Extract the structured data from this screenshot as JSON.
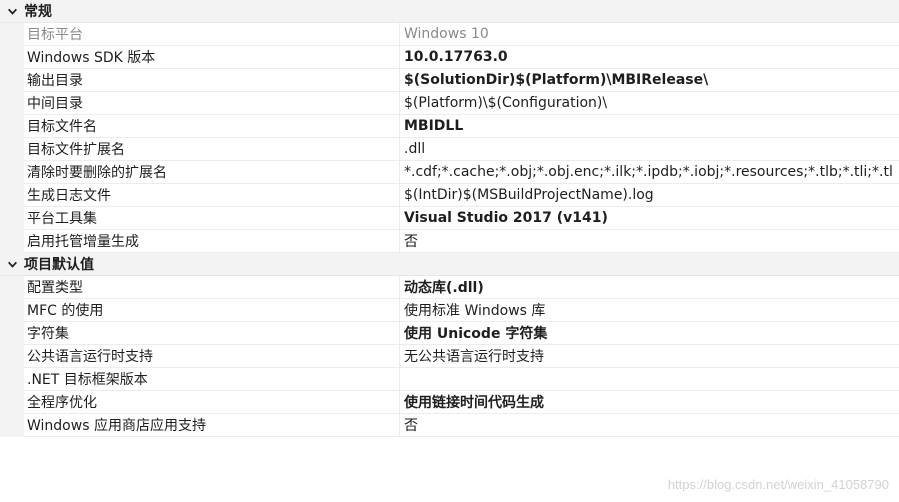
{
  "sections": [
    {
      "title": "常规",
      "rows": [
        {
          "name": "目标平台",
          "value": "Windows 10"
        },
        {
          "name": "Windows SDK 版本",
          "value": "10.0.17763.0"
        },
        {
          "name": "输出目录",
          "value": "$(SolutionDir)$(Platform)\\MBIRelease\\"
        },
        {
          "name": "中间目录",
          "value": "$(Platform)\\$(Configuration)\\"
        },
        {
          "name": "目标文件名",
          "value": "MBIDLL"
        },
        {
          "name": "目标文件扩展名",
          "value": ".dll"
        },
        {
          "name": "清除时要删除的扩展名",
          "value": "*.cdf;*.cache;*.obj;*.obj.enc;*.ilk;*.ipdb;*.iobj;*.resources;*.tlb;*.tli;*.tl"
        },
        {
          "name": "生成日志文件",
          "value": "$(IntDir)$(MSBuildProjectName).log"
        },
        {
          "name": "平台工具集",
          "value": "Visual Studio 2017 (v141)"
        },
        {
          "name": "启用托管增量生成",
          "value": "否"
        }
      ]
    },
    {
      "title": "项目默认值",
      "rows": [
        {
          "name": "配置类型",
          "value": "动态库(.dll)"
        },
        {
          "name": "MFC 的使用",
          "value": "使用标准 Windows 库"
        },
        {
          "name": "字符集",
          "value": "使用 Unicode 字符集"
        },
        {
          "name": "公共语言运行时支持",
          "value": "无公共语言运行时支持"
        },
        {
          "name": ".NET 目标框架版本",
          "value": ""
        },
        {
          "name": "全程序优化",
          "value": "使用链接时间代码生成"
        },
        {
          "name": "Windows 应用商店应用支持",
          "value": "否"
        }
      ]
    }
  ],
  "watermark": "https://blog.csdn.net/weixin_41058790"
}
